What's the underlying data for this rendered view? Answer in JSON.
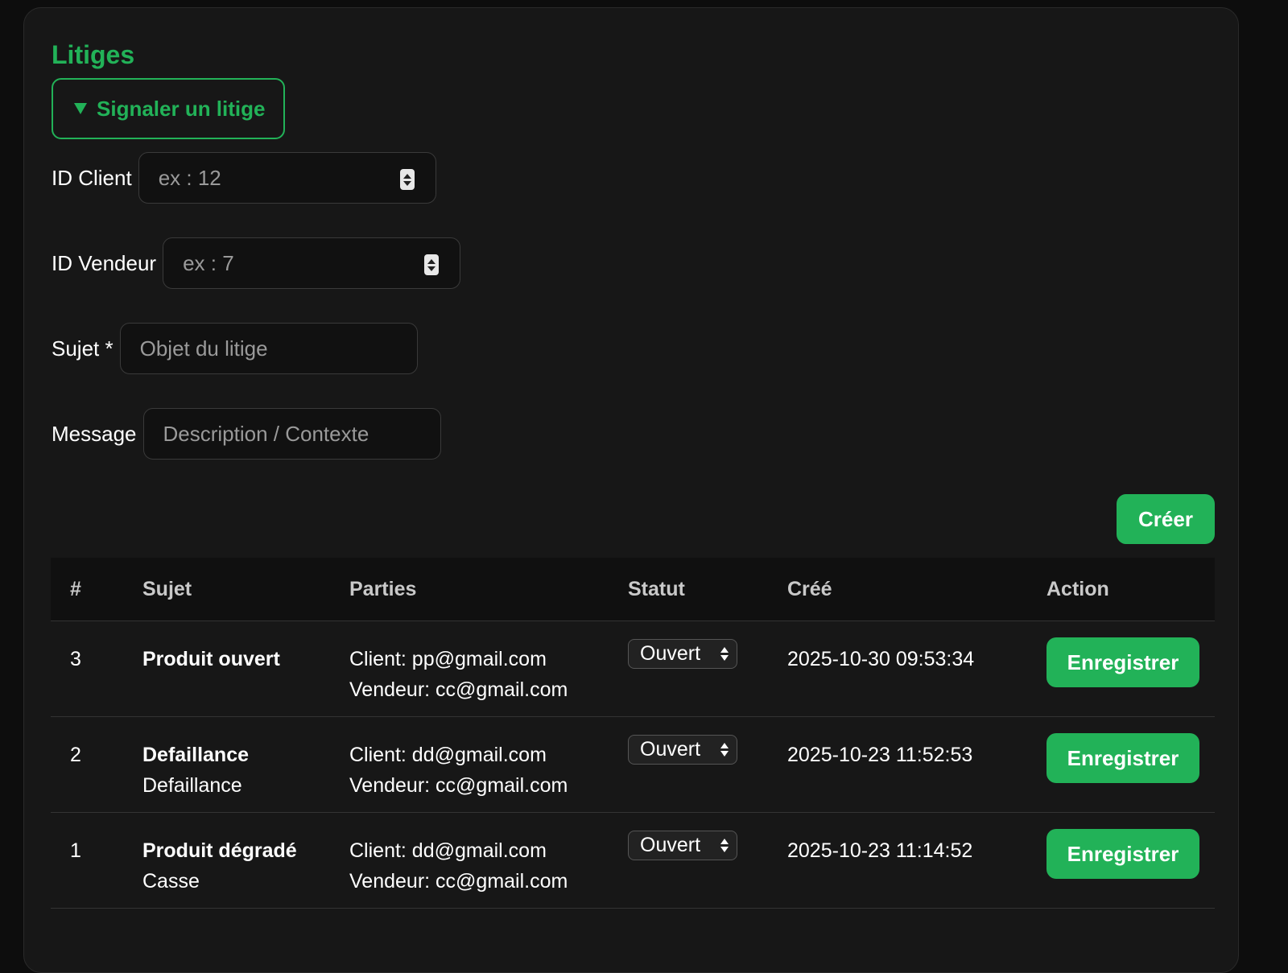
{
  "title": "Litiges",
  "form": {
    "summary_label": "Signaler un litige",
    "client_id": {
      "label": "ID Client",
      "placeholder": "ex : 12"
    },
    "seller_id": {
      "label": "ID Vendeur",
      "placeholder": "ex : 7"
    },
    "subject": {
      "label": "Sujet *",
      "placeholder": "Objet du litige"
    },
    "message": {
      "label": "Message",
      "placeholder": "Description / Contexte"
    },
    "create_label": "Créer"
  },
  "table": {
    "headers": [
      "#",
      "Sujet",
      "Parties",
      "Statut",
      "Créé",
      "Action"
    ],
    "rows": [
      {
        "id": "3",
        "subject": "Produit ouvert",
        "detail": "",
        "client": "Client: pp@gmail.com",
        "seller": "Vendeur: cc@gmail.com",
        "status": "Ouvert",
        "created": "2025-10-30 09:53:34",
        "action": "Enregistrer"
      },
      {
        "id": "2",
        "subject": "Defaillance",
        "detail": "Defaillance",
        "client": "Client: dd@gmail.com",
        "seller": "Vendeur: cc@gmail.com",
        "status": "Ouvert",
        "created": "2025-10-23 11:52:53",
        "action": "Enregistrer"
      },
      {
        "id": "1",
        "subject": "Produit dégradé",
        "detail": "Casse",
        "client": "Client: dd@gmail.com",
        "seller": "Vendeur: cc@gmail.com",
        "status": "Ouvert",
        "created": "2025-10-23 11:14:52",
        "action": "Enregistrer"
      }
    ]
  },
  "colors": {
    "accent": "#22b258",
    "background": "#171717"
  },
  "icons": {
    "summary": "triangle-down-icon",
    "spinner": "number-spinner-icon",
    "select": "select-arrows-icon"
  }
}
